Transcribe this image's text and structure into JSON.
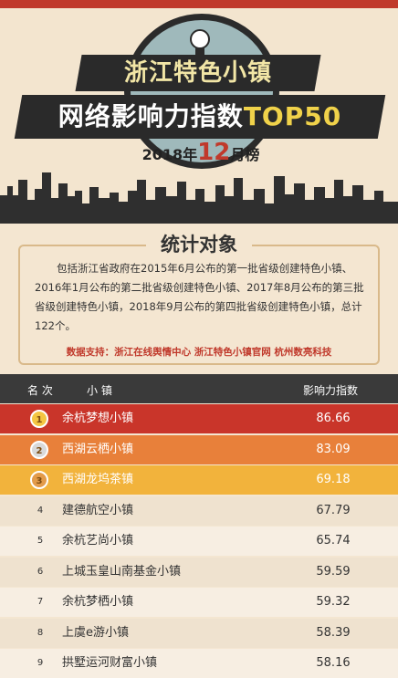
{
  "header": {
    "title_line1": "浙江特色小镇",
    "title_line2_part1": "网络影响力指数",
    "title_line2_part2": "TOP50",
    "date_prefix": "2018年",
    "date_month": "12",
    "date_suffix": "月榜"
  },
  "stats": {
    "title": "统计对象",
    "body": "包括浙江省政府在2015年6月公布的第一批省级创建特色小镇、2016年1月公布的第二批省级创建特色小镇、2017年8月公布的第三批省级创建特色小镇，2018年9月公布的第四批省级创建特色小镇，总计122个。",
    "source": "数据支持：浙江在线舆情中心  浙江特色小镇官网  杭州数亮科技"
  },
  "table": {
    "col_rank": "名 次",
    "col_name": "小 镇",
    "col_score": "影响力指数",
    "rows": [
      {
        "rank": "1",
        "name": "余杭梦想小镇",
        "score": "86.66"
      },
      {
        "rank": "2",
        "name": "西湖云栖小镇",
        "score": "83.09"
      },
      {
        "rank": "3",
        "name": "西湖龙坞茶镇",
        "score": "69.18"
      },
      {
        "rank": "4",
        "name": "建德航空小镇",
        "score": "67.79"
      },
      {
        "rank": "5",
        "name": "余杭艺尚小镇",
        "score": "65.74"
      },
      {
        "rank": "6",
        "name": "上城玉皇山南基金小镇",
        "score": "59.59"
      },
      {
        "rank": "7",
        "name": "余杭梦栖小镇",
        "score": "59.32"
      },
      {
        "rank": "8",
        "name": "上虞e游小镇",
        "score": "58.39"
      },
      {
        "rank": "9",
        "name": "拱墅运河财富小镇",
        "score": "58.16"
      }
    ]
  },
  "colors": {
    "accent_red": "#c0392b",
    "row1_bg": "#c9352a",
    "row2_bg": "#e8803a",
    "row3_bg": "#f2b33c",
    "row_light": "#f7eee2",
    "row_alt": "#efe2cf"
  }
}
